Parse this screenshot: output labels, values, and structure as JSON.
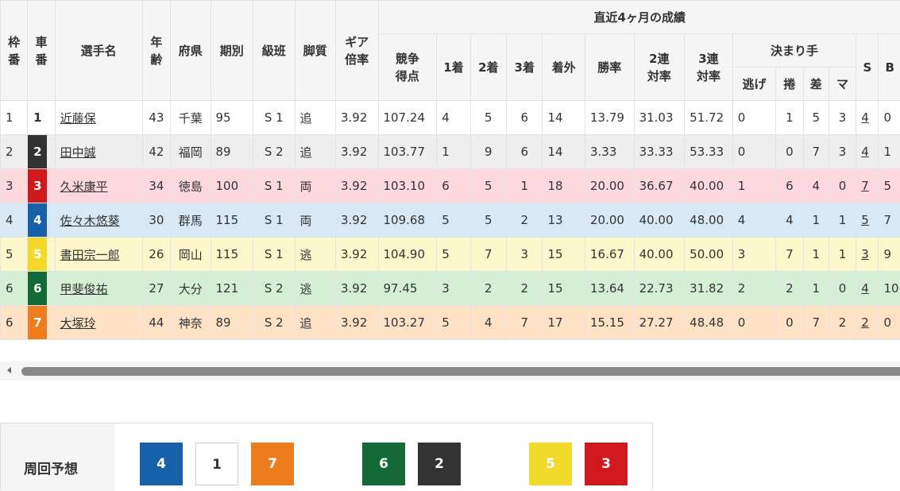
{
  "header": {
    "waku": "枠番",
    "sha": "車番",
    "name": "選手名",
    "age": "年齢",
    "pref": "府県",
    "term": "期別",
    "class": "級班",
    "leg": "脚質",
    "gear": "ギア倍率",
    "recent": "直近4ヶ月の成績",
    "score": "競争得点",
    "first": "1着",
    "second": "2着",
    "third": "3着",
    "out": "着外",
    "win": "勝率",
    "rentai2": "2連対率",
    "rentai3": "3連対率",
    "kimarite": "決まり手",
    "nige": "逃げ",
    "makuri": "捲",
    "sashi": "差",
    "mark": "マ",
    "s": "S",
    "b": "B"
  },
  "colors": {
    "1": {
      "bg": "#ffffff",
      "fg": "#333333",
      "row": "#ffffff"
    },
    "2": {
      "bg": "#333333",
      "fg": "#ffffff",
      "row": "#eeeeee"
    },
    "3": {
      "bg": "#d0191c",
      "fg": "#ffffff",
      "row": "#fdd8df"
    },
    "4": {
      "bg": "#1660a8",
      "fg": "#ffffff",
      "row": "#d7e8f6"
    },
    "5": {
      "bg": "#f2d92b",
      "fg": "#ffffff",
      "row": "#fdf8cc"
    },
    "6": {
      "bg": "#136a36",
      "fg": "#ffffff",
      "row": "#d5efd5"
    },
    "7": {
      "bg": "#ee7d1e",
      "fg": "#ffffff",
      "row": "#fde2c5"
    }
  },
  "riders": [
    {
      "waku": "1",
      "sha": "1",
      "name": "近藤保",
      "age": "43",
      "pref": "千葉",
      "term": "95",
      "class": "S 1",
      "leg": "追",
      "gear": "3.92",
      "score": "107.24",
      "f1": "4",
      "f2": "5",
      "f3": "6",
      "out": "14",
      "win": "13.79",
      "r2": "31.03",
      "r3": "51.72",
      "nige": "0",
      "makuri": "1",
      "sashi": "5",
      "mark": "3",
      "s": "4",
      "b": "0"
    },
    {
      "waku": "2",
      "sha": "2",
      "name": "田中誠",
      "age": "42",
      "pref": "福岡",
      "term": "89",
      "class": "S 2",
      "leg": "追",
      "gear": "3.92",
      "score": "103.77",
      "f1": "1",
      "f2": "9",
      "f3": "6",
      "out": "14",
      "win": "3.33",
      "r2": "33.33",
      "r3": "53.33",
      "nige": "0",
      "makuri": "0",
      "sashi": "7",
      "mark": "3",
      "s": "4",
      "b": "1"
    },
    {
      "waku": "3",
      "sha": "3",
      "name": "久米康平",
      "age": "34",
      "pref": "徳島",
      "term": "100",
      "class": "S 1",
      "leg": "両",
      "gear": "3.92",
      "score": "103.10",
      "f1": "6",
      "f2": "5",
      "f3": "1",
      "out": "18",
      "win": "20.00",
      "r2": "36.67",
      "r3": "40.00",
      "nige": "1",
      "makuri": "6",
      "sashi": "4",
      "mark": "0",
      "s": "7",
      "b": "5"
    },
    {
      "waku": "4",
      "sha": "4",
      "name": "佐々木悠葵",
      "age": "30",
      "pref": "群馬",
      "term": "115",
      "class": "S 1",
      "leg": "両",
      "gear": "3.92",
      "score": "109.68",
      "f1": "5",
      "f2": "5",
      "f3": "2",
      "out": "13",
      "win": "20.00",
      "r2": "40.00",
      "r3": "48.00",
      "nige": "4",
      "makuri": "4",
      "sashi": "1",
      "mark": "1",
      "s": "5",
      "b": "7"
    },
    {
      "waku": "5",
      "sha": "5",
      "name": "書田宗一郎",
      "age": "26",
      "pref": "岡山",
      "term": "115",
      "class": "S 1",
      "leg": "逃",
      "gear": "3.92",
      "score": "104.90",
      "f1": "5",
      "f2": "7",
      "f3": "3",
      "out": "15",
      "win": "16.67",
      "r2": "40.00",
      "r3": "50.00",
      "nige": "3",
      "makuri": "7",
      "sashi": "1",
      "mark": "1",
      "s": "3",
      "b": "9"
    },
    {
      "waku": "6",
      "sha": "6",
      "name": "甲斐俊祐",
      "age": "27",
      "pref": "大分",
      "term": "121",
      "class": "S 2",
      "leg": "逃",
      "gear": "3.92",
      "score": "97.45",
      "f1": "3",
      "f2": "2",
      "f3": "2",
      "out": "15",
      "win": "13.64",
      "r2": "22.73",
      "r3": "31.82",
      "nige": "2",
      "makuri": "2",
      "sashi": "1",
      "mark": "0",
      "s": "4",
      "b": "10"
    },
    {
      "waku": "6",
      "sha": "7",
      "name": "大塚玲",
      "age": "44",
      "pref": "神奈",
      "term": "89",
      "class": "S 2",
      "leg": "追",
      "gear": "3.92",
      "score": "103.27",
      "f1": "5",
      "f2": "4",
      "f3": "7",
      "out": "17",
      "win": "15.15",
      "r2": "27.27",
      "r3": "48.48",
      "nige": "0",
      "makuri": "0",
      "sashi": "7",
      "mark": "2",
      "s": "2",
      "b": "0"
    }
  ],
  "forecast": {
    "label": "周回予想",
    "boxes": [
      {
        "num": "4",
        "color": "4"
      },
      {
        "num": "1",
        "color": "1"
      },
      {
        "num": "7",
        "color": "7"
      },
      {
        "num": "6",
        "color": "6"
      },
      {
        "num": "2",
        "color": "2"
      },
      {
        "num": "5",
        "color": "5"
      },
      {
        "num": "3",
        "color": "3"
      }
    ]
  }
}
